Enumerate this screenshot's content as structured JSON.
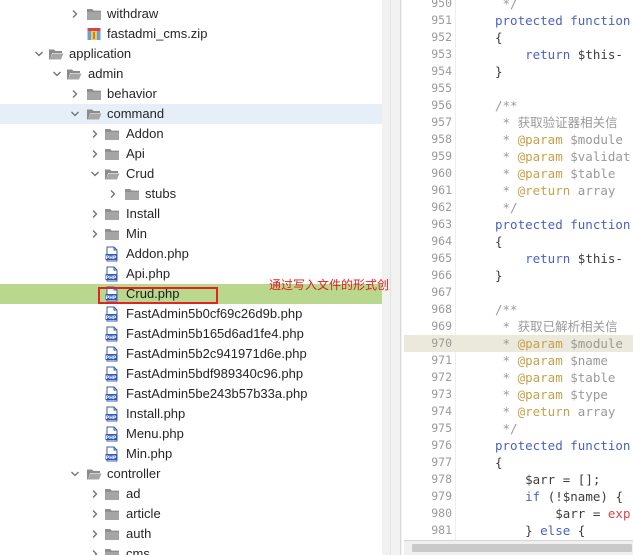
{
  "tree": {
    "rows": [
      {
        "label": "withdraw",
        "kind": "folder",
        "open": false,
        "depth": 3,
        "state": ""
      },
      {
        "label": "fastadmi_cms.zip",
        "kind": "zip",
        "depth": 3,
        "state": ""
      },
      {
        "label": "application",
        "kind": "folder",
        "open": true,
        "depth": 1,
        "state": ""
      },
      {
        "label": "admin",
        "kind": "folder",
        "open": true,
        "depth": 2,
        "state": ""
      },
      {
        "label": "behavior",
        "kind": "folder",
        "open": false,
        "depth": 3,
        "state": ""
      },
      {
        "label": "command",
        "kind": "folder",
        "open": true,
        "depth": 3,
        "state": "selected"
      },
      {
        "label": "Addon",
        "kind": "folder",
        "open": false,
        "depth": 4,
        "state": ""
      },
      {
        "label": "Api",
        "kind": "folder",
        "open": false,
        "depth": 4,
        "state": ""
      },
      {
        "label": "Crud",
        "kind": "folder",
        "open": true,
        "depth": 4,
        "state": ""
      },
      {
        "label": "stubs",
        "kind": "folder",
        "open": false,
        "depth": 5,
        "state": ""
      },
      {
        "label": "Install",
        "kind": "folder",
        "open": false,
        "depth": 4,
        "state": ""
      },
      {
        "label": "Min",
        "kind": "folder",
        "open": false,
        "depth": 4,
        "state": ""
      },
      {
        "label": "Addon.php",
        "kind": "php",
        "depth": 4,
        "state": ""
      },
      {
        "label": "Api.php",
        "kind": "php",
        "depth": 4,
        "state": ""
      },
      {
        "label": "Crud.php",
        "kind": "php",
        "depth": 4,
        "state": "highlighted"
      },
      {
        "label": "FastAdmin5b0cf69c26d9b.php",
        "kind": "php",
        "depth": 4,
        "state": ""
      },
      {
        "label": "FastAdmin5b165d6ad1fe4.php",
        "kind": "php",
        "depth": 4,
        "state": ""
      },
      {
        "label": "FastAdmin5b2c941971d6e.php",
        "kind": "php",
        "depth": 4,
        "state": ""
      },
      {
        "label": "FastAdmin5bdf989340c96.php",
        "kind": "php",
        "depth": 4,
        "state": ""
      },
      {
        "label": "FastAdmin5be243b57b33a.php",
        "kind": "php",
        "depth": 4,
        "state": ""
      },
      {
        "label": "Install.php",
        "kind": "php",
        "depth": 4,
        "state": ""
      },
      {
        "label": "Menu.php",
        "kind": "php",
        "depth": 4,
        "state": ""
      },
      {
        "label": "Min.php",
        "kind": "php",
        "depth": 4,
        "state": ""
      },
      {
        "label": "controller",
        "kind": "folder",
        "open": true,
        "depth": 3,
        "state": ""
      },
      {
        "label": "ad",
        "kind": "folder",
        "open": false,
        "depth": 4,
        "state": ""
      },
      {
        "label": "article",
        "kind": "folder",
        "open": false,
        "depth": 4,
        "state": ""
      },
      {
        "label": "auth",
        "kind": "folder",
        "open": false,
        "depth": 4,
        "state": ""
      },
      {
        "label": "cms",
        "kind": "folder",
        "open": false,
        "depth": 4,
        "state": ""
      }
    ]
  },
  "annotation": {
    "text": "通过写入文件的形式创建控制器等",
    "color": "#e01e1e"
  },
  "editor": {
    "active_line": "970",
    "lines": [
      {
        "n": "950",
        "tokens": [
          {
            "t": "cm",
            "v": " */"
          }
        ]
      },
      {
        "n": "951",
        "tokens": [
          {
            "t": "kw",
            "v": "protected function"
          }
        ]
      },
      {
        "n": "952",
        "tokens": [
          {
            "t": "pun",
            "v": "{"
          }
        ]
      },
      {
        "n": "953",
        "tokens": [
          {
            "t": "pun",
            "v": "    "
          },
          {
            "t": "kw",
            "v": "return"
          },
          {
            "t": "var",
            "v": " $this-"
          }
        ]
      },
      {
        "n": "954",
        "tokens": [
          {
            "t": "pun",
            "v": "}"
          }
        ]
      },
      {
        "n": "955",
        "tokens": []
      },
      {
        "n": "956",
        "tokens": [
          {
            "t": "cm",
            "v": "/**"
          }
        ]
      },
      {
        "n": "957",
        "tokens": [
          {
            "t": "cm",
            "v": " * 获取验证器相关信"
          }
        ]
      },
      {
        "n": "958",
        "tokens": [
          {
            "t": "cm",
            "v": " * "
          },
          {
            "t": "ann",
            "v": "@param"
          },
          {
            "t": "cm",
            "v": " $module"
          }
        ]
      },
      {
        "n": "959",
        "tokens": [
          {
            "t": "cm",
            "v": " * "
          },
          {
            "t": "ann",
            "v": "@param"
          },
          {
            "t": "cm",
            "v": " $validat"
          }
        ]
      },
      {
        "n": "960",
        "tokens": [
          {
            "t": "cm",
            "v": " * "
          },
          {
            "t": "ann",
            "v": "@param"
          },
          {
            "t": "cm",
            "v": " $table"
          }
        ]
      },
      {
        "n": "961",
        "tokens": [
          {
            "t": "cm",
            "v": " * "
          },
          {
            "t": "ann",
            "v": "@return"
          },
          {
            "t": "cm",
            "v": " array"
          }
        ]
      },
      {
        "n": "962",
        "tokens": [
          {
            "t": "cm",
            "v": " */"
          }
        ]
      },
      {
        "n": "963",
        "tokens": [
          {
            "t": "kw",
            "v": "protected function"
          }
        ]
      },
      {
        "n": "964",
        "tokens": [
          {
            "t": "pun",
            "v": "{"
          }
        ]
      },
      {
        "n": "965",
        "tokens": [
          {
            "t": "pun",
            "v": "    "
          },
          {
            "t": "kw",
            "v": "return"
          },
          {
            "t": "var",
            "v": " $this-"
          }
        ]
      },
      {
        "n": "966",
        "tokens": [
          {
            "t": "pun",
            "v": "}"
          }
        ]
      },
      {
        "n": "967",
        "tokens": []
      },
      {
        "n": "968",
        "tokens": [
          {
            "t": "cm",
            "v": "/**"
          }
        ]
      },
      {
        "n": "969",
        "tokens": [
          {
            "t": "cm",
            "v": " * 获取已解析相关信"
          }
        ]
      },
      {
        "n": "970",
        "tokens": [
          {
            "t": "cm",
            "v": " * "
          },
          {
            "t": "ann",
            "v": "@param"
          },
          {
            "t": "cm",
            "v": " $module"
          }
        ]
      },
      {
        "n": "971",
        "tokens": [
          {
            "t": "cm",
            "v": " * "
          },
          {
            "t": "ann",
            "v": "@param"
          },
          {
            "t": "cm",
            "v": " $name"
          }
        ]
      },
      {
        "n": "972",
        "tokens": [
          {
            "t": "cm",
            "v": " * "
          },
          {
            "t": "ann",
            "v": "@param"
          },
          {
            "t": "cm",
            "v": " $table"
          }
        ]
      },
      {
        "n": "973",
        "tokens": [
          {
            "t": "cm",
            "v": " * "
          },
          {
            "t": "ann",
            "v": "@param"
          },
          {
            "t": "cm",
            "v": " $type"
          }
        ]
      },
      {
        "n": "974",
        "tokens": [
          {
            "t": "cm",
            "v": " * "
          },
          {
            "t": "ann",
            "v": "@return"
          },
          {
            "t": "cm",
            "v": " array"
          }
        ]
      },
      {
        "n": "975",
        "tokens": [
          {
            "t": "cm",
            "v": " */"
          }
        ]
      },
      {
        "n": "976",
        "tokens": [
          {
            "t": "kw",
            "v": "protected function"
          }
        ]
      },
      {
        "n": "977",
        "tokens": [
          {
            "t": "pun",
            "v": "{"
          }
        ]
      },
      {
        "n": "978",
        "tokens": [
          {
            "t": "pun",
            "v": "    "
          },
          {
            "t": "var",
            "v": "$arr"
          },
          {
            "t": "pun",
            "v": " = [];"
          }
        ]
      },
      {
        "n": "979",
        "tokens": [
          {
            "t": "pun",
            "v": "    "
          },
          {
            "t": "kw",
            "v": "if"
          },
          {
            "t": "pun",
            "v": " (!"
          },
          {
            "t": "var",
            "v": "$name"
          },
          {
            "t": "pun",
            "v": ") {"
          }
        ]
      },
      {
        "n": "980",
        "tokens": [
          {
            "t": "pun",
            "v": "        "
          },
          {
            "t": "var",
            "v": "$arr"
          },
          {
            "t": "pun",
            "v": " = "
          },
          {
            "t": "str",
            "v": "exp"
          }
        ]
      },
      {
        "n": "981",
        "tokens": [
          {
            "t": "pun",
            "v": "    } "
          },
          {
            "t": "kw",
            "v": "else"
          },
          {
            "t": "pun",
            "v": " {"
          }
        ]
      }
    ]
  }
}
